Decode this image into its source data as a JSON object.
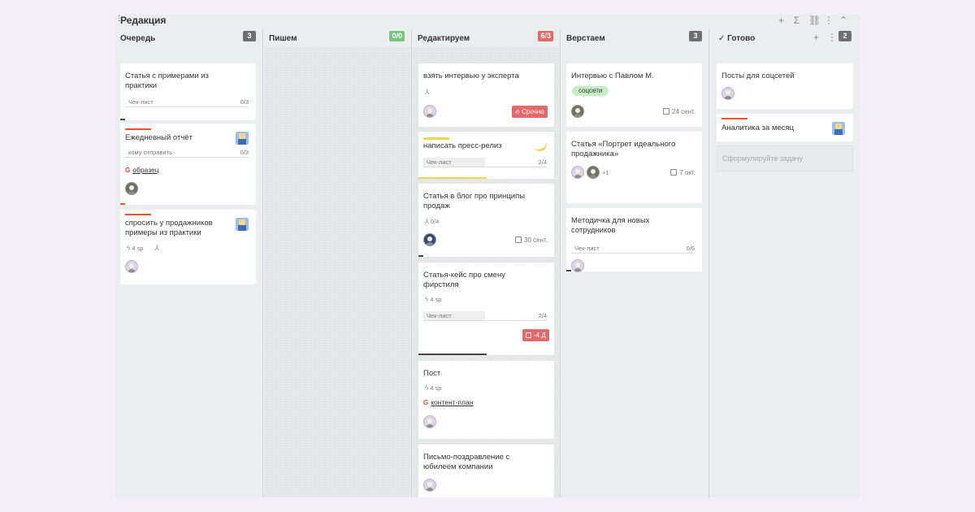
{
  "board": {
    "title": "Редакция",
    "tools": [
      {
        "icon": "plus-icon",
        "glyph": "+"
      },
      {
        "icon": "sigma-icon",
        "glyph": "Σ"
      },
      {
        "icon": "link-icon",
        "glyph": "⛓"
      },
      {
        "icon": "more-icon",
        "glyph": "⋮"
      },
      {
        "icon": "collapse-icon",
        "glyph": "⌃"
      }
    ]
  },
  "columns": [
    {
      "title": "Очередь",
      "badge": "3",
      "cards": [
        {
          "title": "Статья с примерами из практики",
          "checklist_label": "Чек-лист",
          "checklist_count": "0/3"
        },
        {
          "title": "Ежедневный отчёт",
          "checklist_label": "кому отправить",
          "checklist_count": "0/3",
          "link": "образец"
        },
        {
          "title": "спросить у продажников примеры из практики",
          "sp": "4 sp"
        }
      ]
    },
    {
      "title": "Пишем",
      "badge": "0/0",
      "cards": []
    },
    {
      "title": "Редактируем",
      "badge": "6/3",
      "cards": [
        {
          "title": "взять интервью у эксперта",
          "label": "Срочно"
        },
        {
          "title": "написать пресс-релиз",
          "checklist_label": "Чек-лист",
          "checklist_count": "2/4"
        },
        {
          "title": "Статья в блог про принципы продаж",
          "subtasks": "0/4",
          "date": "30 сент."
        },
        {
          "title": "Статья-кейс про смену фирстиля",
          "sp": "4 sp",
          "checklist_label": "Чек-лист",
          "checklist_count": "2/4",
          "overdue": "-4 Д"
        },
        {
          "title": "Пост",
          "sp": "4 sp",
          "link": "контент-план"
        },
        {
          "title": "Письмо-поздравление с юбилеем компании"
        }
      ]
    },
    {
      "title": "Верстаем",
      "badge": "3",
      "cards": [
        {
          "title": "Интервью с Павлом М.",
          "tag": "соцсети",
          "date": "24 сент."
        },
        {
          "title": "Статья «Портрет идеального продажника»",
          "extra_members": "+1",
          "date": "7 окт."
        },
        {
          "title": "Методичка для новых сотрудников",
          "checklist_label": "Чек-лист",
          "checklist_count": "0/6"
        }
      ]
    },
    {
      "title": "Готово",
      "badge": "2",
      "cards": [
        {
          "title": "Посты для соцсетей"
        },
        {
          "title": "Аналитика за месяц"
        }
      ],
      "new_task_placeholder": "Сформулируйте задачу"
    }
  ],
  "colors": {
    "background": "#f3eefb",
    "board": "#ebeeef",
    "urgent": "#e36a6a",
    "ok": "#79c77c",
    "priority_bar": "#e8552b",
    "highlight_bar": "#f0d64a"
  },
  "progress": {
    "col1_card1_checklist": 0.0,
    "col1_card2_checklist": 0.0,
    "col3_card2_checklist": 0.5,
    "col3_card4_checklist": 0.5,
    "col4_card3_checklist": 0.0
  }
}
